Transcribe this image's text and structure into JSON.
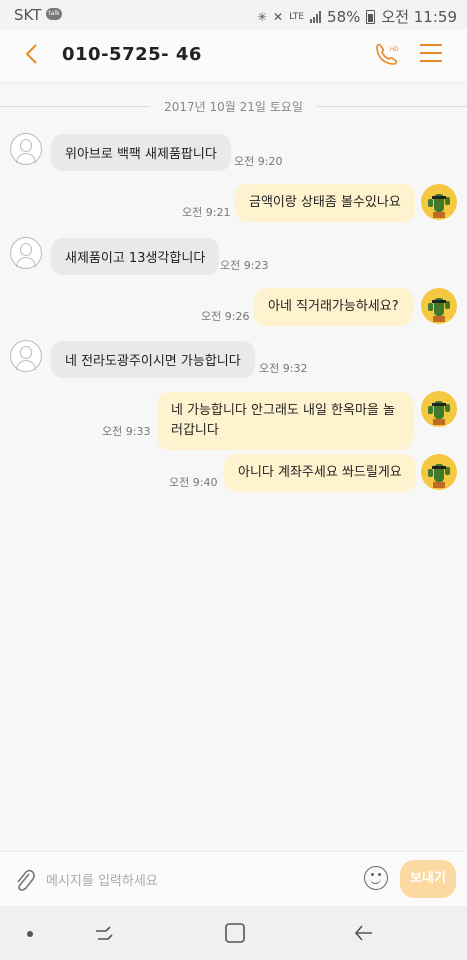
{
  "status": {
    "carrier": "SKT",
    "talk_badge": "talk",
    "network": "LTE",
    "battery": "58%",
    "time": "오전 11:59"
  },
  "header": {
    "phone_number": "010-5725- 46"
  },
  "date_divider": "2017년 10월 21일 토요일",
  "messages": [
    {
      "direction": "in",
      "text": "위아브로 백팩 새제품팝니다",
      "time": "오전 9:20"
    },
    {
      "direction": "out",
      "text": "금액이랑 상태좀 볼수있나요",
      "time": "오전 9:21"
    },
    {
      "direction": "in",
      "text": "새제품이고 13생각합니다",
      "time": "오전 9:23"
    },
    {
      "direction": "out",
      "text": "아네  직거래가능하세요?",
      "time": "오전 9:26"
    },
    {
      "direction": "in",
      "text": "네 전라도광주이시면 가능합니다",
      "time": "오전 9:32"
    },
    {
      "direction": "out",
      "text": "네 가능합니다 안그래도 내일 한옥마을 놀러갑니다",
      "time": "오전 9:33"
    },
    {
      "direction": "out",
      "text": "아니다 계좌주세요 쏴드릴게요",
      "time": "오전 9:40"
    }
  ],
  "input": {
    "placeholder": "메시지를 입력하세요",
    "send_label": "보내기"
  },
  "colors": {
    "accent": "#e98a2a",
    "incoming_bubble": "#e9e9e9",
    "outgoing_bubble": "#fff3cf",
    "send_button": "#fbd9a0"
  },
  "icons": [
    "back-arrow-icon",
    "hd-call-icon",
    "menu-icon",
    "attach-icon",
    "emoji-icon",
    "recent-apps-icon",
    "home-icon",
    "back-nav-icon"
  ]
}
